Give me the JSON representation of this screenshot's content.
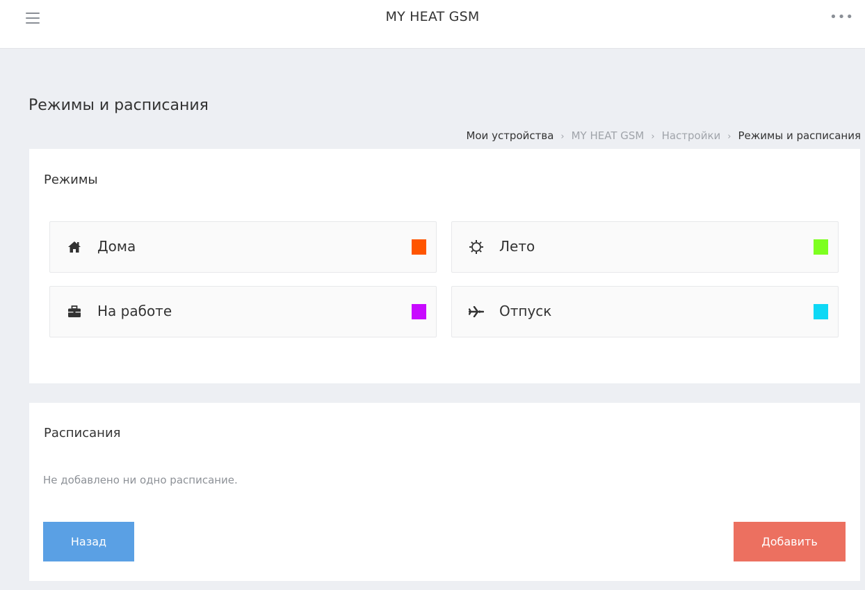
{
  "header": {
    "title": "MY HEAT GSM",
    "menu_icon": "hamburger-menu-icon",
    "more_icon": "ellipsis-icon",
    "more_glyph": "•••"
  },
  "page": {
    "title": "Режимы и расписания"
  },
  "breadcrumb": {
    "items": [
      "Мои устройства",
      "MY HEAT GSM",
      "Настройки",
      "Режимы и расписания"
    ],
    "separator": "›"
  },
  "modes": {
    "title": "Режимы",
    "items": [
      {
        "label": "Дома",
        "icon": "home-icon",
        "color": "#ff5500"
      },
      {
        "label": "Лето",
        "icon": "sun-icon",
        "color": "#7dff1f"
      },
      {
        "label": "На работе",
        "icon": "briefcase-icon",
        "color": "#c80aff"
      },
      {
        "label": "Отпуск",
        "icon": "airplane-icon",
        "color": "#0fd8f5"
      }
    ]
  },
  "schedules": {
    "title": "Расписания",
    "empty_text": "Не добавлено ни одно расписание.",
    "back_label": "Назад",
    "add_label": "Добавить"
  },
  "colors": {
    "back_button": "#5aa0e4",
    "add_button": "#ec7060",
    "background": "#edeff3"
  }
}
